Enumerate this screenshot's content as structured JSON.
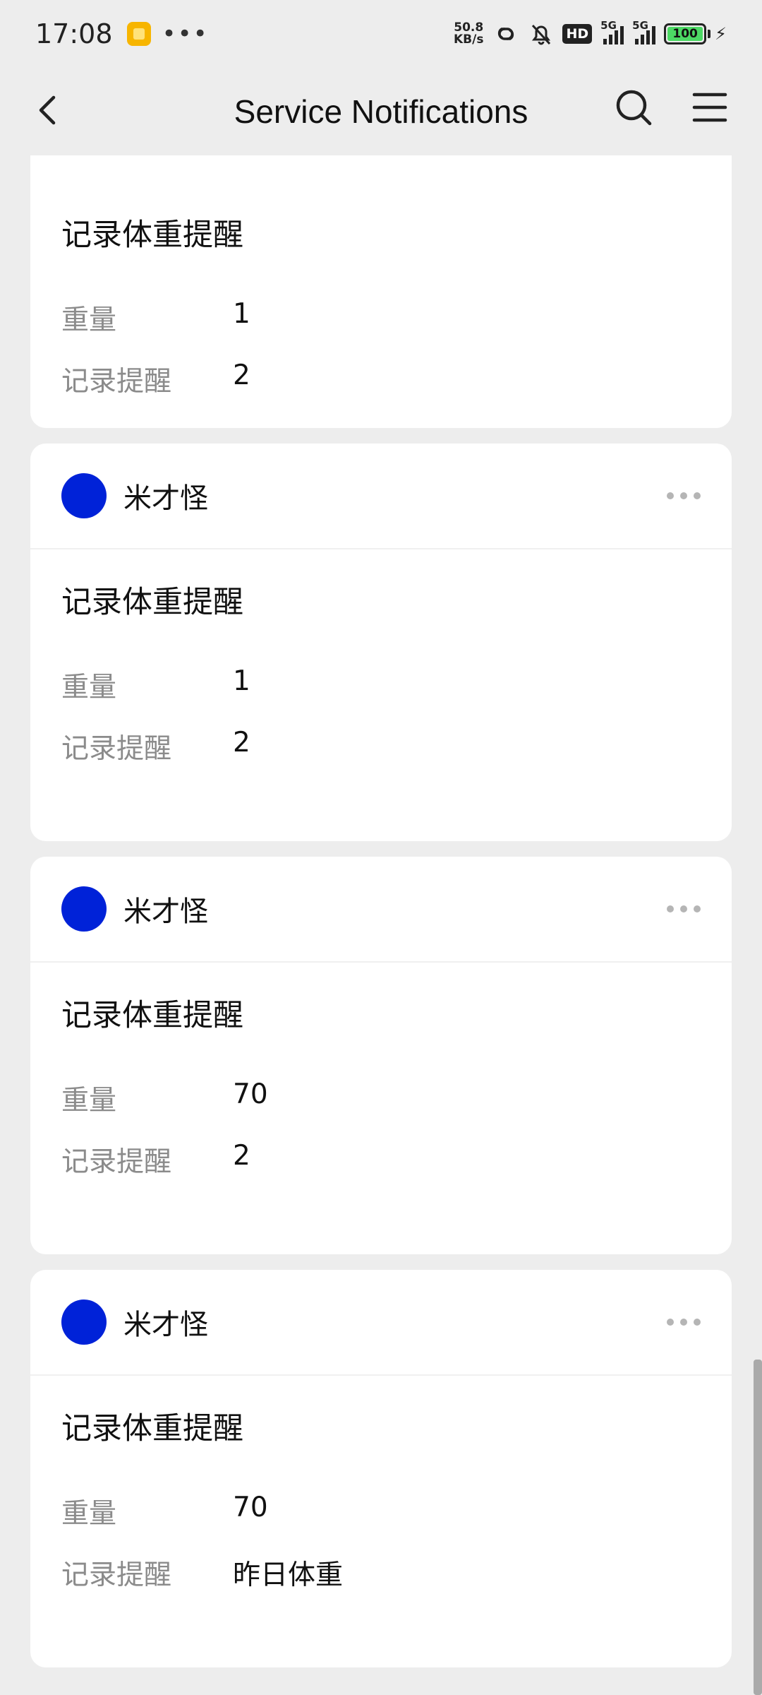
{
  "status_bar": {
    "time": "17:08",
    "more": "•••",
    "speed_top": "50.8",
    "speed_bottom": "KB/s",
    "hd": "HD",
    "net1": "5G",
    "net2": "5G",
    "battery": "100"
  },
  "nav": {
    "title": "Service Notifications"
  },
  "cards": [
    {
      "title": "记录体重提醒",
      "rows": [
        {
          "label": "重量",
          "value": "1"
        },
        {
          "label": "记录提醒",
          "value": "2"
        }
      ]
    },
    {
      "sender": "米才怪",
      "title": "记录体重提醒",
      "rows": [
        {
          "label": "重量",
          "value": "1"
        },
        {
          "label": "记录提醒",
          "value": "2"
        }
      ]
    },
    {
      "sender": "米才怪",
      "title": "记录体重提醒",
      "rows": [
        {
          "label": "重量",
          "value": "70"
        },
        {
          "label": "记录提醒",
          "value": "2"
        }
      ]
    },
    {
      "sender": "米才怪",
      "title": "记录体重提醒",
      "rows": [
        {
          "label": "重量",
          "value": "70"
        },
        {
          "label": "记录提醒",
          "value": "昨日体重"
        }
      ]
    }
  ],
  "colors": {
    "avatar": "#0022d8",
    "background": "#ededed",
    "card": "#ffffff",
    "label": "#8b8b8b"
  }
}
